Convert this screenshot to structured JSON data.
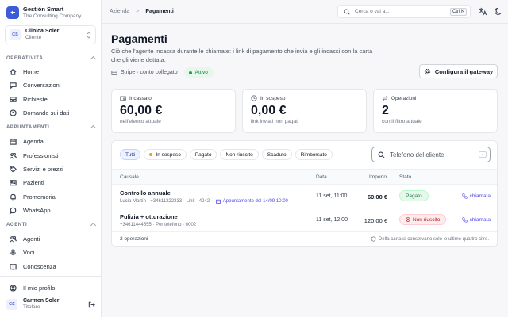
{
  "brand": {
    "name": "Gestión Smart",
    "subtitle": "The Consulting Company"
  },
  "client": {
    "initials": "CS",
    "name": "Clinica Soler",
    "role": "Cliente"
  },
  "sections": {
    "operativita": "OPERATIVITÀ",
    "appuntamenti": "APPUNTAMENTI",
    "agenti": "AGENTI"
  },
  "nav": {
    "operativita": [
      {
        "label": "Home",
        "icon": "home-icon"
      },
      {
        "label": "Conversazioni",
        "icon": "chat-icon"
      },
      {
        "label": "Richieste",
        "icon": "inbox-icon"
      },
      {
        "label": "Domande sui dati",
        "icon": "question-chat-icon"
      }
    ],
    "appuntamenti": [
      {
        "label": "Agenda",
        "icon": "calendar-icon"
      },
      {
        "label": "Professionisti",
        "icon": "users-icon"
      },
      {
        "label": "Servizi e prezzi",
        "icon": "tag-icon"
      },
      {
        "label": "Pazienti",
        "icon": "id-card-icon"
      },
      {
        "label": "Promemoria",
        "icon": "bell-icon"
      },
      {
        "label": "WhatsApp",
        "icon": "whatsapp-icon"
      }
    ],
    "agenti": [
      {
        "label": "Agenti",
        "icon": "users-icon"
      },
      {
        "label": "Voci",
        "icon": "microphone-icon"
      },
      {
        "label": "Conoscenza",
        "icon": "book-icon"
      }
    ],
    "profile": {
      "label": "Il mio profilo",
      "icon": "user-icon"
    }
  },
  "user": {
    "initials": "CS",
    "name": "Carmen Soler",
    "role": "Titolare"
  },
  "breadcrumb": {
    "parent": "Azienda",
    "separator": ">",
    "current": "Pagamenti"
  },
  "search": {
    "placeholder": "Cerca o vai a...",
    "shortcut": "Ctrl K"
  },
  "page": {
    "title": "Pagamenti",
    "description": "Ciò che l'agente incassa durante le chiamate: i link di pagamento che invia e gli incassi con la carta che gli viene dettata.",
    "stripe_status": "Stripe · conto collegato",
    "stripe_badge": "Attivo",
    "gateway_button": "Configura il gateway"
  },
  "cards": [
    {
      "label": "Incassato",
      "value": "60,00 €",
      "sub": "nell'elenco attuale",
      "icon": "wallet-icon"
    },
    {
      "label": "In sospeso",
      "value": "0,00 €",
      "sub": "link inviati non pagati",
      "icon": "clock-icon"
    },
    {
      "label": "Operazioni",
      "value": "2",
      "sub": "con il filtro attuale",
      "icon": "transfer-icon"
    }
  ],
  "filters": [
    "Tutti",
    "In sospeso",
    "Pagato",
    "Non riuscito",
    "Scaduto",
    "Rimborsato"
  ],
  "active_filter": "Tutti",
  "phone_search": {
    "placeholder": "Telefono del cliente",
    "shortcut": "/"
  },
  "table": {
    "columns": {
      "cause": "Causale",
      "date": "Data",
      "amount": "Importo",
      "status": "Stato"
    },
    "rows": [
      {
        "title": "Controllo annuale",
        "meta": "Lucia Martín · +34611222333 · Link · 4242 ·",
        "appointment": "Appuntamento del 14/09 10:00",
        "date": "11 set, 11:00",
        "amount": "60,00 €",
        "status": "Pagato",
        "action": "chiamata"
      },
      {
        "title": "Pulizia + otturazione",
        "meta": "+34611444555 · Per telefono · 0002",
        "appointment": "",
        "date": "11 set, 12:00",
        "amount": "120,00 €",
        "status": "Non riuscito",
        "action": "chiamata"
      }
    ],
    "footer_count": "2 operazioni",
    "footer_note": "Della carta si conservano solo le ultime quattro cifre."
  },
  "colors": {
    "accent": "#3b5bdb",
    "link": "#4f46e5",
    "success": "#15803d",
    "danger": "#b91c1c"
  }
}
